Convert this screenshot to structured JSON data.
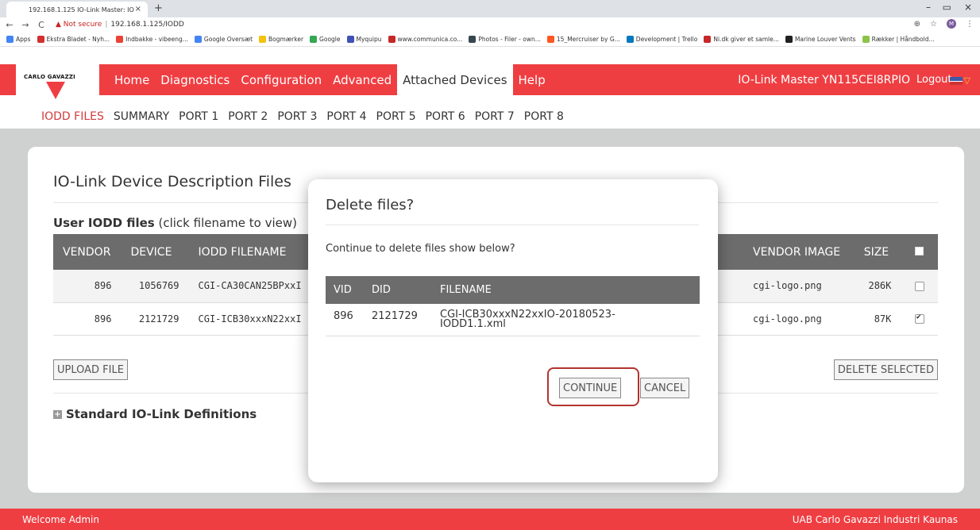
{
  "browser": {
    "tab_title": "192.168.1.125 IO-Link Master: IO",
    "tab_close": "×",
    "new_tab": "+",
    "security": "Not secure",
    "url": "192.168.1.125/IODD",
    "window_minimize": "–",
    "window_restore": "▭",
    "window_close": "×",
    "bookmarks": [
      {
        "label": "Apps",
        "color": "#4285f4"
      },
      {
        "label": "Ekstra Bladet - Nyh...",
        "color": "#d32f2f"
      },
      {
        "label": "Indbakke - vibeeng...",
        "color": "#ea4335"
      },
      {
        "label": "Google Oversæt",
        "color": "#4285f4"
      },
      {
        "label": "Bogmærker",
        "color": "#f4c20d"
      },
      {
        "label": "Google",
        "color": "#34a853"
      },
      {
        "label": "Myquipu",
        "color": "#3f51b5"
      },
      {
        "label": "www.communica.co...",
        "color": "#c62828"
      },
      {
        "label": "Photos - Filer - own...",
        "color": "#37474f"
      },
      {
        "label": "15_Mercruiser by G...",
        "color": "#ff5722"
      },
      {
        "label": "Development | Trello",
        "color": "#0079bf"
      },
      {
        "label": "Ni.dk giver et samle...",
        "color": "#c62828"
      },
      {
        "label": "Marine Louver Vents",
        "color": "#212121"
      },
      {
        "label": "Rækker | Håndbold...",
        "color": "#8bc34a"
      }
    ]
  },
  "header": {
    "logo_text": "CARLO GAVAZZI",
    "nav": [
      {
        "label": "Home",
        "active": false
      },
      {
        "label": "Diagnostics",
        "active": false
      },
      {
        "label": "Configuration",
        "active": false
      },
      {
        "label": "Advanced",
        "active": false
      },
      {
        "label": "Attached Devices",
        "active": true
      },
      {
        "label": "Help",
        "active": false
      }
    ],
    "device_name": "IO-Link Master YN115CEI8RPIO",
    "logout": "Logout"
  },
  "subnav": [
    {
      "label": "IODD FILES",
      "active": true
    },
    {
      "label": "SUMMARY",
      "active": false
    },
    {
      "label": "PORT 1",
      "active": false
    },
    {
      "label": "PORT 2",
      "active": false
    },
    {
      "label": "PORT 3",
      "active": false
    },
    {
      "label": "PORT 4",
      "active": false
    },
    {
      "label": "PORT 5",
      "active": false
    },
    {
      "label": "PORT 6",
      "active": false
    },
    {
      "label": "PORT 7",
      "active": false
    },
    {
      "label": "PORT 8",
      "active": false
    }
  ],
  "main": {
    "title": "IO-Link Device Description Files",
    "user_iodd_bold": "User IODD files",
    "user_iodd_hint": " (click filename to view)",
    "columns": {
      "vendor": "VENDOR",
      "device": "DEVICE",
      "filename": "IODD FILENAME",
      "vendor_image": "VENDOR IMAGE",
      "size": "SIZE"
    },
    "rows": [
      {
        "vendor": "896",
        "device": "1056769",
        "filename": "CGI-CA30CAN25BPxxI",
        "image": "cgi-logo.png",
        "size": "286K",
        "checked": false
      },
      {
        "vendor": "896",
        "device": "2121729",
        "filename": "CGI-ICB30xxxN22xxI",
        "image": "cgi-logo.png",
        "size": "87K",
        "checked": true
      }
    ],
    "upload_button": "UPLOAD FILE",
    "delete_selected_button": "DELETE SELECTED",
    "standard_defs": "Standard IO-Link Definitions"
  },
  "modal": {
    "title": "Delete files?",
    "message": "Continue to delete files show below?",
    "columns": {
      "vid": "VID",
      "did": "DID",
      "filename": "FILENAME"
    },
    "rows": [
      {
        "vid": "896",
        "did": "2121729",
        "filename_line1": "CGI-ICB30xxxN22xxIO-20180523-",
        "filename_line2": "IODD1.1.xml"
      }
    ],
    "continue_button": "CONTINUE",
    "cancel_button": "CANCEL"
  },
  "footer": {
    "left": "Welcome Admin",
    "right": "UAB Carlo Gavazzi Industri Kaunas"
  },
  "colors": {
    "brand_red": "#ef3e42",
    "table_header": "#6c6c6c",
    "highlight_ring": "#b2342f"
  }
}
